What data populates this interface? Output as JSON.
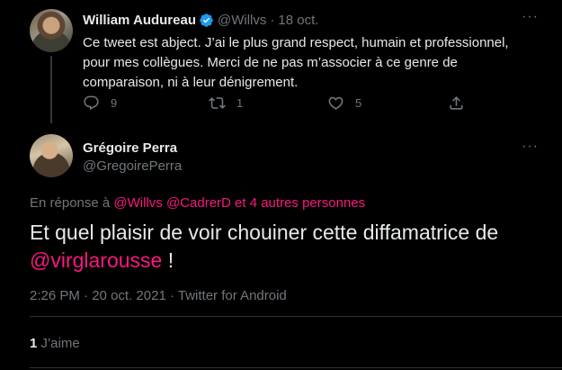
{
  "reply_tweet": {
    "author_name": "William Audureau",
    "handle": "@Willvs",
    "date": "18 oct.",
    "text": "Ce tweet est abject. J’ai le plus grand respect, humain et professionnel,\npour mes collègues. Merci de ne pas m’associer à ce genre de\ncomparaison, ni à leur dénigrement.",
    "reply_count": "9",
    "retweet_count": "1",
    "like_count": "5",
    "verified": true
  },
  "main_tweet": {
    "author_name": "Grégoire Perra",
    "handle": "@GregoirePerra",
    "reply_prefix": "En réponse à",
    "reply_mentions": "@Willvs @CadrerD  et 4 autres personnes",
    "text_before": "Et quel plaisir de voir chouiner cette diffamatrice de",
    "mention": "@virglarousse",
    "text_after": " !",
    "time": "2:26 PM",
    "date": "20 oct. 2021",
    "source": "Twitter for Android",
    "likes_count": "1",
    "likes_label": "J’aime"
  },
  "icons": {
    "verified": "verified-badge-icon",
    "more": "more-horizontal-icon",
    "reply": "reply-icon",
    "retweet": "retweet-icon",
    "like": "heart-icon",
    "share": "share-icon"
  },
  "colors": {
    "background": "#000000",
    "text": "#e7e9ea",
    "muted": "#71767b",
    "link": "#f91880",
    "divider": "#2f3336",
    "verified": "#1d9bf0"
  }
}
